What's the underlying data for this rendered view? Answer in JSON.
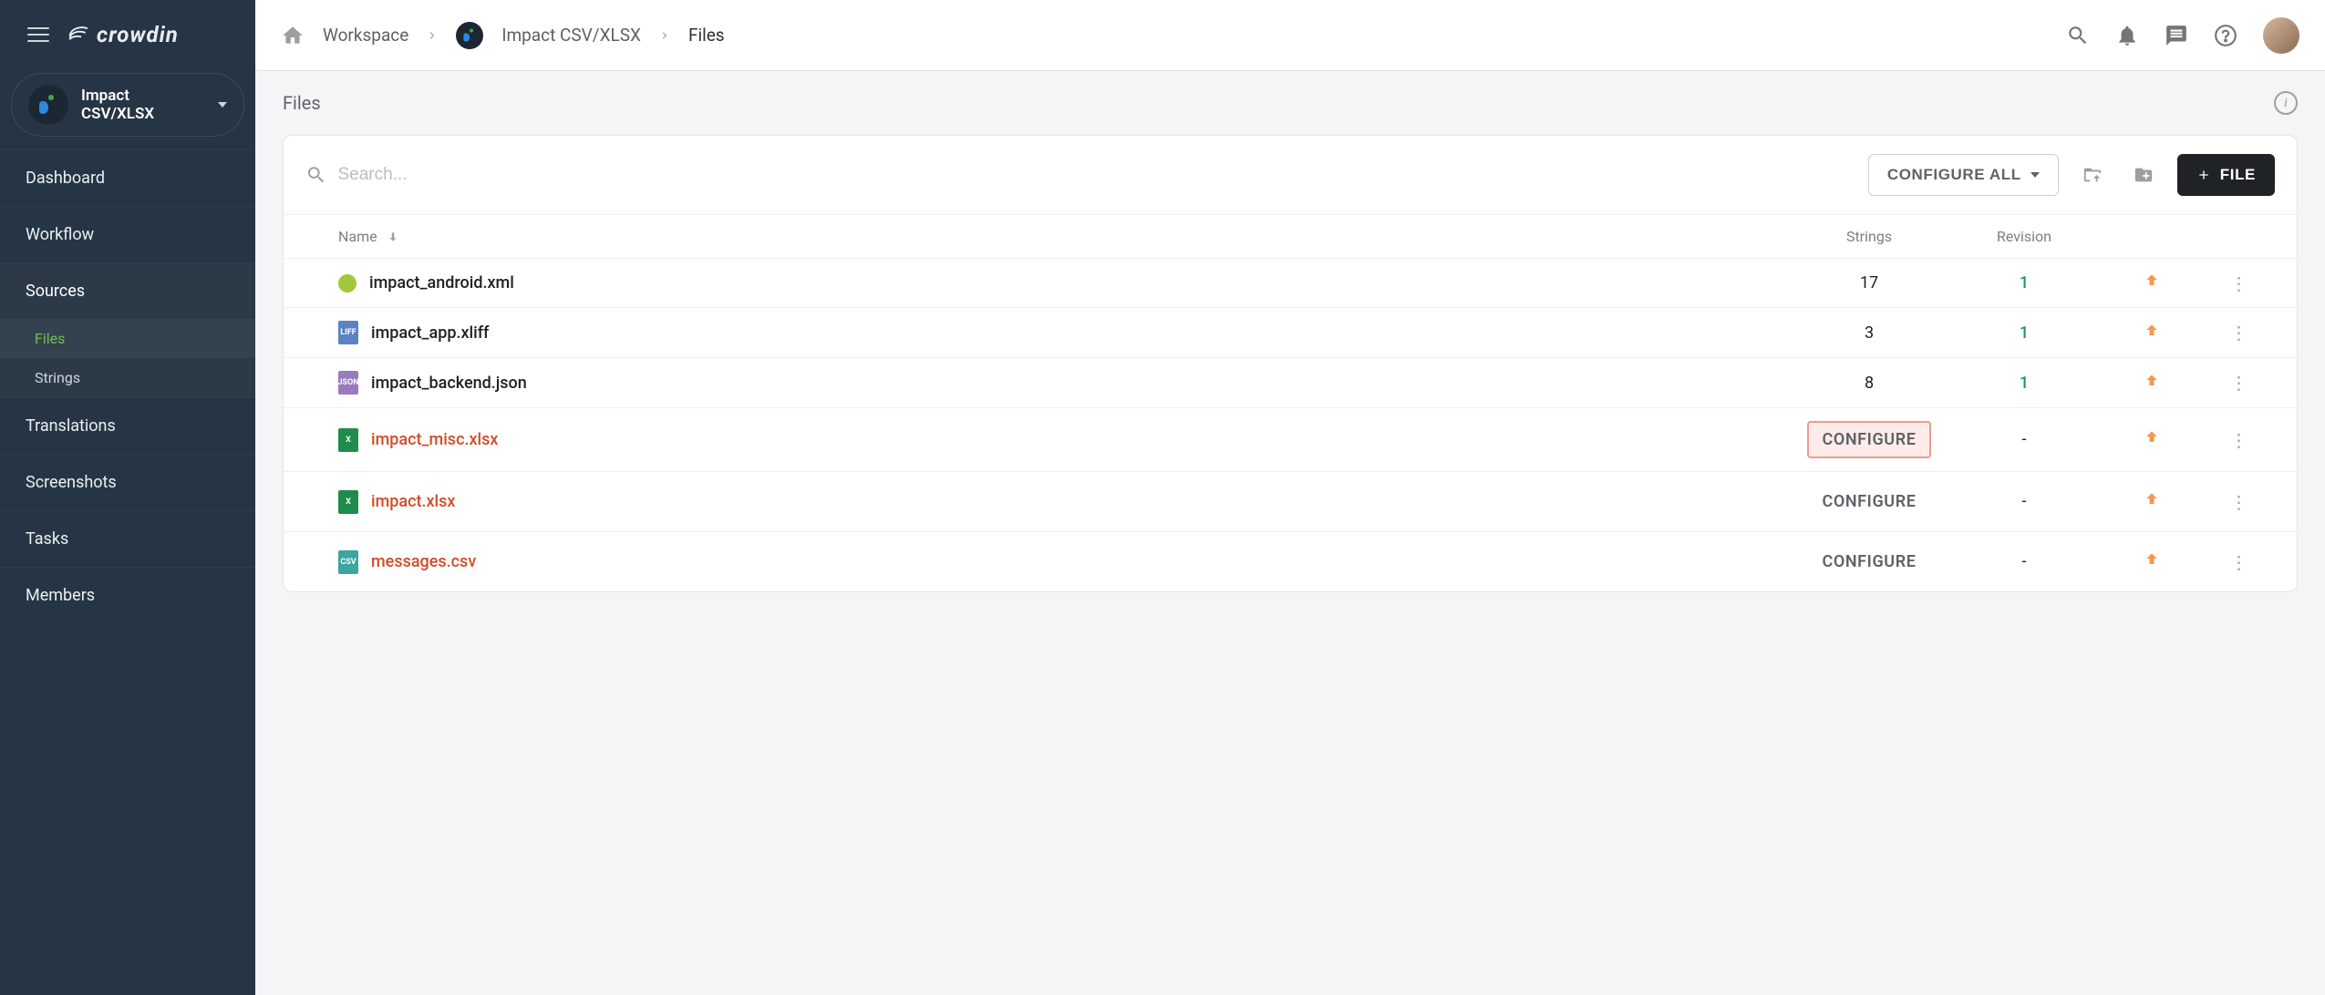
{
  "brand": "crowdin",
  "project_selector": {
    "name": "Impact CSV/XLSX"
  },
  "sidebar": {
    "items": [
      {
        "label": "Dashboard"
      },
      {
        "label": "Workflow"
      },
      {
        "label": "Sources"
      },
      {
        "label": "Translations"
      },
      {
        "label": "Screenshots"
      },
      {
        "label": "Tasks"
      },
      {
        "label": "Members"
      }
    ],
    "sources_sub": [
      {
        "label": "Files",
        "active": true
      },
      {
        "label": "Strings",
        "active": false
      }
    ]
  },
  "breadcrumb": {
    "workspace": "Workspace",
    "project": "Impact CSV/XLSX",
    "page": "Files"
  },
  "page": {
    "title": "Files"
  },
  "toolbar": {
    "search_placeholder": "Search...",
    "configure_all": "CONFIGURE ALL",
    "file_button": "FILE"
  },
  "table": {
    "headers": {
      "name": "Name",
      "strings": "Strings",
      "revision": "Revision"
    },
    "configure_label": "CONFIGURE",
    "rows": [
      {
        "icon": "android",
        "name": "impact_android.xml",
        "warn": false,
        "strings": "17",
        "revision": "1"
      },
      {
        "icon": "liff",
        "name": "impact_app.xliff",
        "warn": false,
        "strings": "3",
        "revision": "1"
      },
      {
        "icon": "json",
        "name": "impact_backend.json",
        "warn": false,
        "strings": "8",
        "revision": "1"
      },
      {
        "icon": "xlsx",
        "name": "impact_misc.xlsx",
        "warn": true,
        "strings": "configure",
        "revision": "-",
        "highlight": true
      },
      {
        "icon": "xlsx",
        "name": "impact.xlsx",
        "warn": true,
        "strings": "configure",
        "revision": "-"
      },
      {
        "icon": "csv",
        "name": "messages.csv",
        "warn": true,
        "strings": "configure",
        "revision": "-"
      }
    ]
  }
}
